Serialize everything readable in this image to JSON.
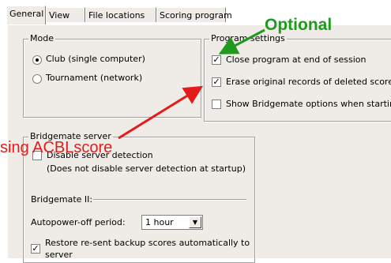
{
  "tabs": [
    "General",
    "View",
    "File locations",
    "Scoring program"
  ],
  "mode": {
    "title": "Mode",
    "options": [
      {
        "label": "Club (single computer)",
        "selected": true
      },
      {
        "label": "Tournament (network)",
        "selected": false
      }
    ]
  },
  "program_settings": {
    "title": "Program settings",
    "items": [
      {
        "label": "Close program at end of session",
        "checked": true
      },
      {
        "label": "Erase original records of deleted scores",
        "checked": true
      },
      {
        "label": "Show Bridgemate options when starting n",
        "checked": false
      }
    ]
  },
  "bridgemate_server": {
    "title": "Bridgemate server",
    "disable_label": "Disable server detection",
    "disable_checked": false,
    "note": "(Does not disable server detection at startup)"
  },
  "bridgemate2": {
    "title": "Bridgemate II:",
    "autopower_label": "Autopower-off period:",
    "autopower_value": "1 hour",
    "restore_line1": "Restore re-sent backup scores automatically to",
    "restore_line2": "server",
    "restore_checked": true
  },
  "annotations": {
    "optional": "Optional",
    "using": "sing ACBLscore",
    "optional_color": "#1f9a1f",
    "using_color": "#e31b1b"
  }
}
